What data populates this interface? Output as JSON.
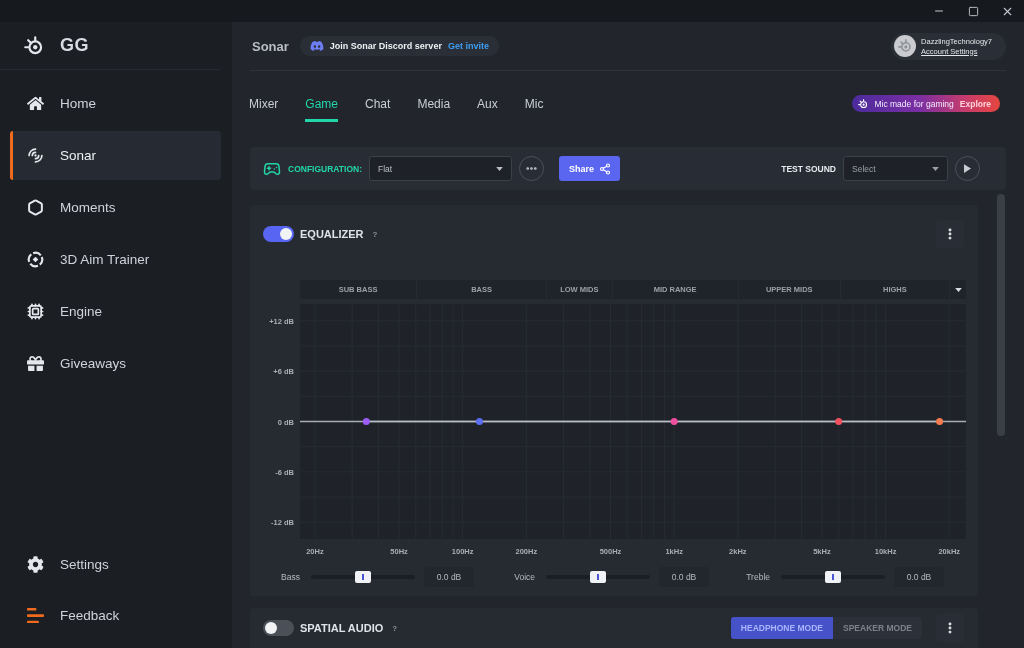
{
  "sidebar": {
    "brand": "GG",
    "items": [
      {
        "label": "Home",
        "selected": false
      },
      {
        "label": "Sonar",
        "selected": true
      },
      {
        "label": "Moments",
        "selected": false
      },
      {
        "label": "3D Aim Trainer",
        "selected": false
      },
      {
        "label": "Engine",
        "selected": false
      },
      {
        "label": "Giveaways",
        "selected": false
      }
    ],
    "footer_items": [
      {
        "label": "Settings",
        "selected": false
      },
      {
        "label": "Feedback",
        "selected": false
      }
    ]
  },
  "header": {
    "title": "Sonar",
    "discord_banner": {
      "text": "Join Sonar Discord server",
      "link": "Get invite"
    },
    "account": {
      "username": "DazzlingTechnology7",
      "link": "Account Settings"
    }
  },
  "tabs": [
    {
      "label": "Mixer",
      "selected": false
    },
    {
      "label": "Game",
      "selected": true
    },
    {
      "label": "Chat",
      "selected": false
    },
    {
      "label": "Media",
      "selected": false
    },
    {
      "label": "Aux",
      "selected": false
    },
    {
      "label": "Mic",
      "selected": false
    }
  ],
  "promo": {
    "text": "Mic made for gaming",
    "link": "Explore"
  },
  "configuration_bar": {
    "label": "CONFIGURATION:",
    "preset": "Flat",
    "share_button": "Share",
    "test_sound_label": "TEST SOUND",
    "test_sound_select": {
      "placeholder": "Select"
    }
  },
  "equalizer": {
    "title": "EQUALIZER",
    "help": "?",
    "on": true,
    "bands": [
      "SUB BASS",
      "BASS",
      "LOW MIDS",
      "MID RANGE",
      "UPPER MIDS",
      "HIGHS"
    ],
    "chart_data": {
      "type": "line",
      "series": [
        {
          "color": "#b9bdc6",
          "values": [
            0,
            0,
            0,
            0,
            0
          ]
        }
      ],
      "ylim": [
        -14,
        14
      ],
      "yticks": [
        {
          "value": 12,
          "label": "+12 dB"
        },
        {
          "value": 6,
          "label": "+6 dB"
        },
        {
          "value": 0,
          "label": "0 dB"
        },
        {
          "value": -6,
          "label": "-6 dB"
        },
        {
          "value": -12,
          "label": "-12 dB"
        }
      ],
      "grid": true
    },
    "frequency_labels": [
      "20Hz",
      "50Hz",
      "100Hz",
      "200Hz",
      "500Hz",
      "1kHz",
      "2kHz",
      "5kHz",
      "10kHz",
      "20kHz"
    ],
    "nodes": [
      {
        "color": "#9a5cf4"
      },
      {
        "color": "#5b6ef2"
      },
      {
        "color": "#ef4f9f"
      },
      {
        "color": "#f0505e"
      },
      {
        "color": "#f47a4f"
      }
    ],
    "controls": [
      {
        "label": "Bass",
        "level": 0.5,
        "reading": "0.0 dB"
      },
      {
        "label": "Voice",
        "level": 0.5,
        "reading": "0.0 dB"
      },
      {
        "label": "Treble",
        "level": 0.5,
        "reading": "0.0 dB"
      }
    ]
  },
  "spatial_audio": {
    "title": "SPATIAL AUDIO",
    "help": "?",
    "on": false,
    "modes": [
      {
        "label": "HEADPHONE MODE",
        "selected": true
      },
      {
        "label": "SPEAKER MODE",
        "selected": false
      }
    ]
  }
}
